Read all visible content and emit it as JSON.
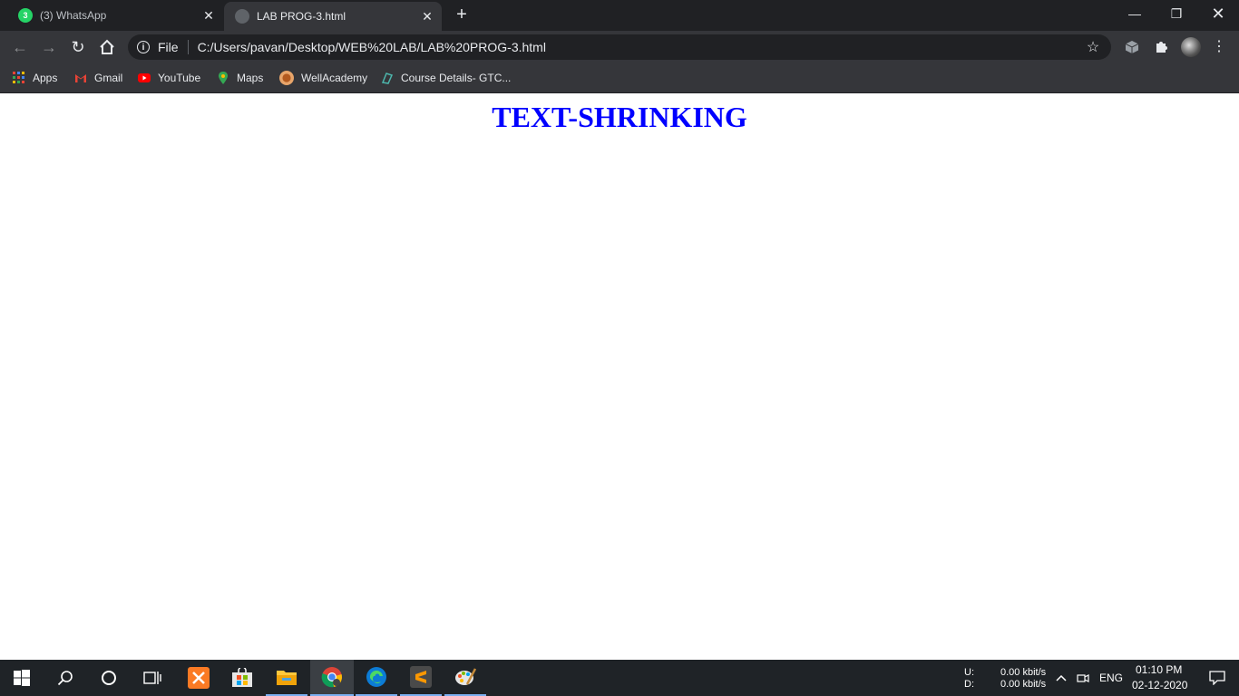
{
  "browser": {
    "tabs": [
      {
        "title": "(3) WhatsApp",
        "badge": "3",
        "active": false
      },
      {
        "title": "LAB PROG-3.html",
        "active": true
      }
    ],
    "omnibox": {
      "scheme_label": "File",
      "url": "C:/Users/pavan/Desktop/WEB%20LAB/LAB%20PROG-3.html"
    },
    "bookmarks": [
      {
        "label": "Apps",
        "icon": "apps-grid-icon"
      },
      {
        "label": "Gmail",
        "icon": "gmail-icon"
      },
      {
        "label": "YouTube",
        "icon": "youtube-icon"
      },
      {
        "label": "Maps",
        "icon": "maps-pin-icon"
      },
      {
        "label": "WellAcademy",
        "icon": "wellacademy-icon"
      },
      {
        "label": "Course Details- GTC...",
        "icon": "course-icon"
      }
    ]
  },
  "page": {
    "heading": "TEXT-SHRINKING",
    "heading_color": "#0000ff"
  },
  "taskbar": {
    "network": {
      "upload_label": "U:",
      "upload_value": "0.00 kbit/s",
      "download_label": "D:",
      "download_value": "0.00 kbit/s"
    },
    "language": "ENG",
    "time": "01:10  PM",
    "date": "02-12-2020",
    "pinned": [
      "search-icon",
      "cortana-icon",
      "task-view-icon",
      "xampp-icon",
      "store-icon",
      "file-explorer-icon",
      "chrome-icon",
      "edge-icon",
      "sublime-text-icon",
      "paint-icon"
    ]
  },
  "colors": {
    "tabstrip_bg": "#202124",
    "toolbar_bg": "#35363a",
    "taskbar_bg": "#1f2327",
    "accent": "#7aaef0"
  }
}
